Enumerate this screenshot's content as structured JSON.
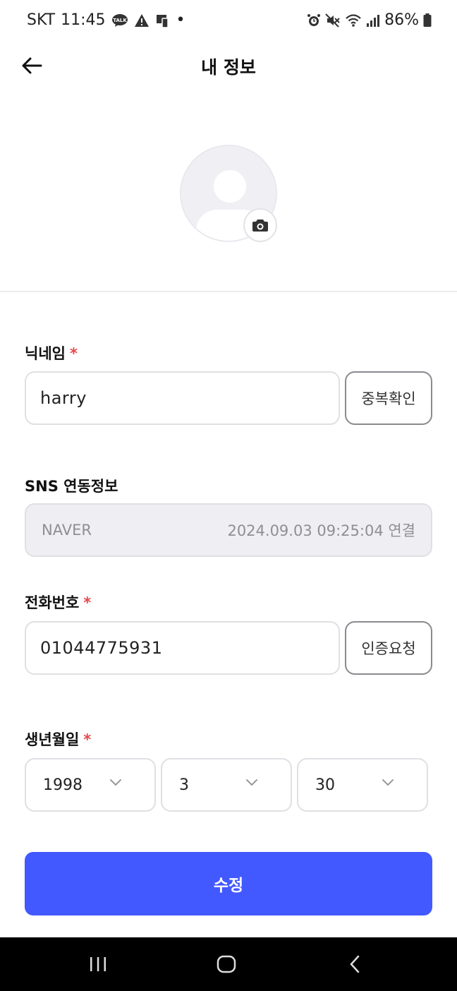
{
  "status_bar": {
    "carrier": "SKT",
    "time": "11:45",
    "dot": "•",
    "battery": "86%"
  },
  "header": {
    "title": "내 정보"
  },
  "form": {
    "nickname": {
      "label": "닉네임",
      "required_mark": "*",
      "value": "harry",
      "check_button": "중복확인"
    },
    "sns": {
      "label": "SNS 연동정보",
      "provider": "NAVER",
      "linked_info": "2024.09.03 09:25:04 연결"
    },
    "phone": {
      "label": "전화번호",
      "required_mark": "*",
      "value": "01044775931",
      "verify_button": "인증요청"
    },
    "birth": {
      "label": "생년월일",
      "required_mark": "*",
      "year": "1998",
      "month": "3",
      "day": "30"
    },
    "submit_label": "수정"
  },
  "colors": {
    "accent": "#4259ff",
    "required": "#e5484d"
  }
}
